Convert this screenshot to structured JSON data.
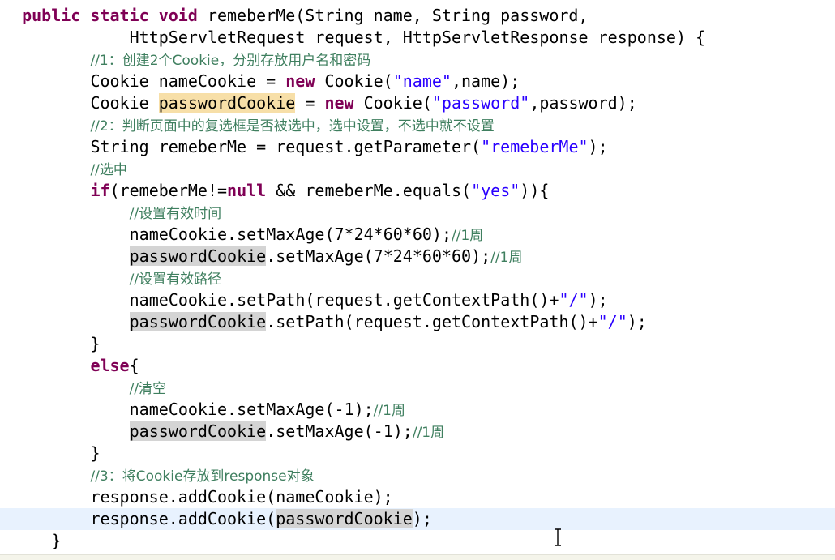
{
  "editor": {
    "top_fragment": "",
    "lines": [
      {
        "indent": 2,
        "tokens": [
          {
            "t": "public",
            "c": "kw"
          },
          {
            "t": " "
          },
          {
            "t": "static",
            "c": "kw"
          },
          {
            "t": " "
          },
          {
            "t": "void",
            "c": "kw"
          },
          {
            "t": " remeberMe(String name, String password,"
          }
        ]
      },
      {
        "indent": 13,
        "tokens": [
          {
            "t": "HttpServletRequest request, HttpServletResponse response) {"
          }
        ]
      },
      {
        "indent": 9,
        "tokens": [
          {
            "t": "//1：创建2个Cookie，分别存放用户名和密码",
            "c": "cmt"
          }
        ]
      },
      {
        "indent": 9,
        "tokens": [
          {
            "t": "Cookie nameCookie = "
          },
          {
            "t": "new",
            "c": "kw"
          },
          {
            "t": " Cookie("
          },
          {
            "t": "\"name\"",
            "c": "str"
          },
          {
            "t": ",name);"
          }
        ]
      },
      {
        "indent": 9,
        "tokens": [
          {
            "t": "Cookie "
          },
          {
            "t": "passwordCookie",
            "c": "occ-write"
          },
          {
            "t": " = "
          },
          {
            "t": "new",
            "c": "kw"
          },
          {
            "t": " Cookie("
          },
          {
            "t": "\"password\"",
            "c": "str"
          },
          {
            "t": ",password);"
          }
        ]
      },
      {
        "indent": 9,
        "tokens": [
          {
            "t": "//2：判断页面中的复选框是否被选中，选中设置，不选中就不设置",
            "c": "cmt"
          }
        ]
      },
      {
        "indent": 9,
        "tokens": [
          {
            "t": "String remeberMe = request.getParameter("
          },
          {
            "t": "\"remeberMe\"",
            "c": "str"
          },
          {
            "t": ");"
          }
        ]
      },
      {
        "indent": 9,
        "tokens": [
          {
            "t": "//选中",
            "c": "cmt"
          }
        ]
      },
      {
        "indent": 9,
        "tokens": [
          {
            "t": "if",
            "c": "kw"
          },
          {
            "t": "(remeberMe!="
          },
          {
            "t": "null",
            "c": "kw"
          },
          {
            "t": " && remeberMe.equals("
          },
          {
            "t": "\"yes\"",
            "c": "str"
          },
          {
            "t": ")){"
          }
        ]
      },
      {
        "indent": 13,
        "tokens": [
          {
            "t": "//设置有效时间",
            "c": "cmt"
          }
        ]
      },
      {
        "indent": 13,
        "tokens": [
          {
            "t": "nameCookie.setMaxAge(7*24*60*60);"
          },
          {
            "t": "//1周",
            "c": "cmt"
          }
        ]
      },
      {
        "indent": 13,
        "tokens": [
          {
            "t": "passwordCookie",
            "c": "occ"
          },
          {
            "t": ".setMaxAge(7*24*60*60);"
          },
          {
            "t": "//1周",
            "c": "cmt"
          }
        ]
      },
      {
        "indent": 13,
        "tokens": [
          {
            "t": "//设置有效路径",
            "c": "cmt"
          }
        ]
      },
      {
        "indent": 13,
        "tokens": [
          {
            "t": "nameCookie.setPath(request.getContextPath()+"
          },
          {
            "t": "\"/\"",
            "c": "str"
          },
          {
            "t": ");"
          }
        ]
      },
      {
        "indent": 13,
        "tokens": [
          {
            "t": "passwordCookie",
            "c": "occ"
          },
          {
            "t": ".setPath(request.getContextPath()+"
          },
          {
            "t": "\"/\"",
            "c": "str"
          },
          {
            "t": ");"
          }
        ]
      },
      {
        "indent": 9,
        "tokens": [
          {
            "t": "}"
          }
        ]
      },
      {
        "indent": 9,
        "tokens": [
          {
            "t": "else",
            "c": "kw"
          },
          {
            "t": "{"
          }
        ]
      },
      {
        "indent": 13,
        "tokens": [
          {
            "t": "//清空",
            "c": "cmt"
          }
        ]
      },
      {
        "indent": 13,
        "tokens": [
          {
            "t": "nameCookie.setMaxAge(-1);"
          },
          {
            "t": "//1周",
            "c": "cmt"
          }
        ]
      },
      {
        "indent": 13,
        "tokens": [
          {
            "t": "passwordCookie",
            "c": "occ"
          },
          {
            "t": ".setMaxAge(-1);"
          },
          {
            "t": "//1周",
            "c": "cmt"
          }
        ]
      },
      {
        "indent": 9,
        "tokens": [
          {
            "t": "}"
          }
        ]
      },
      {
        "indent": 9,
        "tokens": [
          {
            "t": "//3：将Cookie存放到response对象",
            "c": "cmt"
          }
        ]
      },
      {
        "indent": 9,
        "tokens": [
          {
            "t": "response.addCookie(nameCookie);"
          }
        ]
      },
      {
        "indent": 9,
        "current": true,
        "tokens": [
          {
            "t": "response.addCookie("
          },
          {
            "t": "passwordCookie",
            "c": "occ"
          },
          {
            "t": ");"
          }
        ]
      },
      {
        "indent": 5,
        "tokens": [
          {
            "t": "}"
          }
        ]
      }
    ]
  },
  "colors": {
    "keyword": "#7f0055",
    "string": "#2a00ff",
    "comment": "#3f7f5f",
    "occurrence": "#d4d4d4",
    "write_occurrence": "#f7dfa8",
    "current_line": "#e8f2fe"
  },
  "cursor": {
    "icon": "text-ibeam-cursor-icon"
  }
}
